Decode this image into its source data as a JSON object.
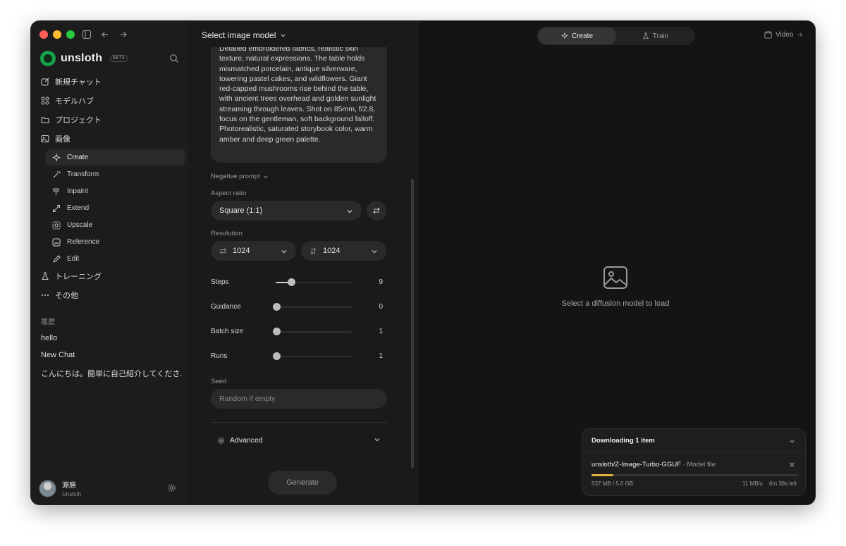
{
  "sidebar": {
    "brand": "unsloth",
    "beta": "BETA",
    "nav": [
      {
        "label": "新規チャット",
        "icon": "edit-icon"
      },
      {
        "label": "モデルハブ",
        "icon": "grid-icon"
      },
      {
        "label": "プロジェクト",
        "icon": "folder-icon"
      },
      {
        "label": "画像",
        "icon": "image-icon"
      }
    ],
    "image_sub": [
      {
        "label": "Create",
        "icon": "sparkle-icon",
        "active": true
      },
      {
        "label": "Transform",
        "icon": "wand-icon"
      },
      {
        "label": "Inpaint",
        "icon": "brush-icon"
      },
      {
        "label": "Extend",
        "icon": "expand-icon"
      },
      {
        "label": "Upscale",
        "icon": "upscale-icon"
      },
      {
        "label": "Reference",
        "icon": "reference-icon"
      },
      {
        "label": "Edit",
        "icon": "pencil-icon"
      }
    ],
    "training": "トレーニング",
    "other": "その他",
    "history_title": "履歴",
    "history": [
      "hello",
      "New Chat",
      "こんにちは。簡単に自己紹介してくださ..."
    ],
    "user": {
      "name": "源勝",
      "org": "Unsloth"
    }
  },
  "panel": {
    "model_select": "Select image model",
    "prompt_text": "Detailed embroidered fabrics, realistic skin texture, natural expressions. The table holds mismatched porcelain, antique silverware, towering pastel cakes, and wildflowers. Giant red-capped mushrooms rise behind the table, with ancient trees overhead and golden sunlight streaming through leaves. Shot on 85mm, f/2.8, focus on the gentleman, soft background falloff. Photorealistic, saturated storybook color, warm amber and deep green palette.",
    "negative_prompt": "Negative prompt",
    "aspect_label": "Aspect ratio",
    "aspect_value": "Square (1:1)",
    "resolution_label": "Resolution",
    "width": "1024",
    "height": "1024",
    "sliders": [
      {
        "label": "Steps",
        "value": "9",
        "fraction": 0.2
      },
      {
        "label": "Guidance",
        "value": "0",
        "fraction": 0
      },
      {
        "label": "Batch size",
        "value": "1",
        "fraction": 0
      },
      {
        "label": "Runs",
        "value": "1",
        "fraction": 0
      }
    ],
    "seed_label": "Seed",
    "seed_placeholder": "Random if empty",
    "advanced": "Advanced",
    "generate": "Generate"
  },
  "main": {
    "tabs": [
      {
        "label": "Create"
      },
      {
        "label": "Train"
      }
    ],
    "video": "Video",
    "empty_text": "Select a diffusion model to load",
    "download": {
      "header": "Downloading 1 item",
      "item": "unsloth/Z-Image-Turbo-GGUF",
      "kind": "· Model file",
      "progress": 0.107,
      "size": "537 MB / 5.0 GB",
      "speed": "11 MB/s",
      "eta": "6m 38s left"
    }
  },
  "colors": {
    "accent": "#e2b13c",
    "brand": "#16a34a"
  }
}
